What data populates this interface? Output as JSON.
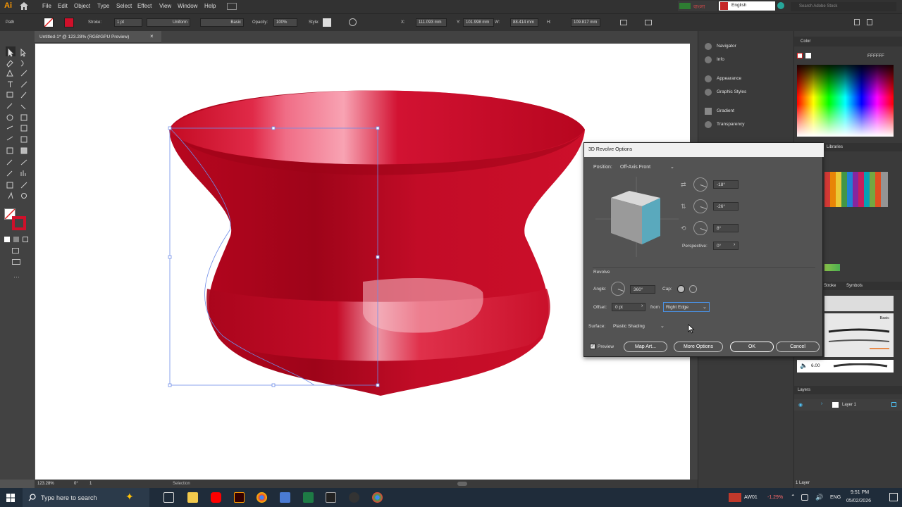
{
  "menubar": {
    "logo": "Ai",
    "items": [
      "File",
      "Edit",
      "Object",
      "Type",
      "Select",
      "Effect",
      "View",
      "Window",
      "Help"
    ],
    "language_chip": "বাংলা",
    "input_language": "English",
    "stock_search_placeholder": "Search Adobe Stock"
  },
  "control_bar": {
    "selection_type": "Path",
    "stroke_label": "Stroke:",
    "stroke_weight": "1 pt",
    "uniform_label": "Uniform",
    "basic_label": "Basic",
    "opacity_label": "Opacity:",
    "opacity_value": "100%",
    "style_label": "Style:",
    "x_label": "X:",
    "x_value": "111.093 mm",
    "y_label": "Y:",
    "y_value": "101.998 mm",
    "w_label": "W:",
    "w_value": "88.414 mm",
    "h_label": "H:",
    "h_value": "109.817 mm"
  },
  "document": {
    "tab_title": "Untitled-1* @ 123.28% (RGB/GPU Preview)"
  },
  "status_bar": {
    "zoom": "123.28%",
    "rotation": "0°",
    "artboard": "1",
    "tool_name": "Selection"
  },
  "dock": {
    "items": [
      "Navigator",
      "Info",
      "Appearance",
      "Graphic Styles",
      "Gradient",
      "Transparency"
    ]
  },
  "color_panel": {
    "title": "Color",
    "hex_value": "FFFFFF"
  },
  "libraries_tab": "Libraries",
  "brushes": {
    "stroke_tab": "Stroke",
    "symbols_tab": "Symbols",
    "basic_label": "Basic",
    "size_value": "6.00"
  },
  "layers": {
    "title": "Layers",
    "items": [
      "Layer 1"
    ],
    "count": "1 Layer"
  },
  "dialog": {
    "title": "3D Revolve Options",
    "position_label": "Position:",
    "position_value": "Off-Axis Front",
    "x_rotation": "-18°",
    "y_rotation": "-26°",
    "z_rotation": "8°",
    "perspective_label": "Perspective:",
    "perspective_value": "0°",
    "revolve_heading": "Revolve",
    "angle_label": "Angle:",
    "angle_value": "360°",
    "cap_label": "Cap:",
    "offset_label": "Offset:",
    "offset_value": "0 pt",
    "from_label": "from",
    "from_value": "Right Edge",
    "surface_label": "Surface:",
    "surface_value": "Plastic Shading",
    "preview_label": "Preview",
    "preview_checked": true,
    "map_art_label": "Map Art...",
    "more_options_label": "More Options",
    "ok_label": "OK",
    "cancel_label": "Cancel"
  },
  "taskbar": {
    "search_placeholder": "Type here to search",
    "stock_ticker": "AW01",
    "stock_change": "-1.29%",
    "language": "ENG",
    "time": "9:51 PM",
    "date": "05/02/2026"
  },
  "colors": {
    "object_red": "#d0102a",
    "accent_orange": "#ff9a00",
    "dialog_cube_face": "#5aa9bd"
  }
}
